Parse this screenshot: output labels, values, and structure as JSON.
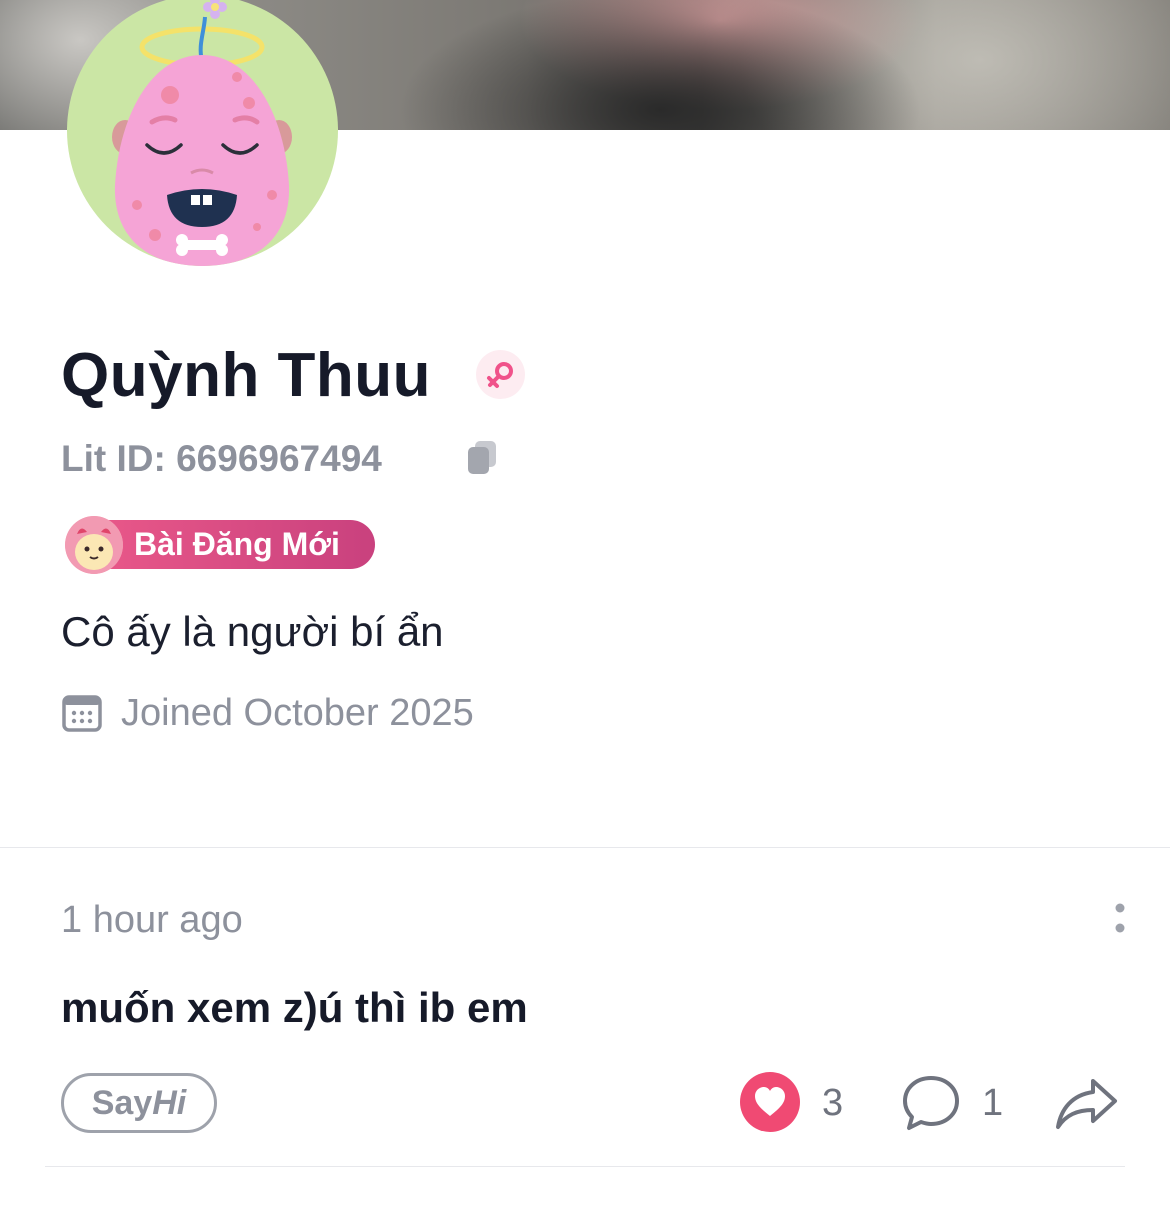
{
  "profile": {
    "name": "Quỳnh Thuu",
    "gender_icon": "female-icon",
    "lit_id": "Lit ID: 6696967494",
    "badge_label": "Bài Đăng Mới",
    "bio": "Cô ấy là người bí ẩn",
    "joined": "Joined October 2025"
  },
  "post": {
    "time": "1 hour ago",
    "text": "muốn xem z)ú thì ib em",
    "sayhi_say": "Say",
    "sayhi_hi": "Hi",
    "likes": "3",
    "comments": "1"
  },
  "colors": {
    "accent_pink": "#ec5a8a",
    "like_red": "#f04a73",
    "muted_text": "#8d919c",
    "avatar_bg": "#cbe6a5"
  }
}
